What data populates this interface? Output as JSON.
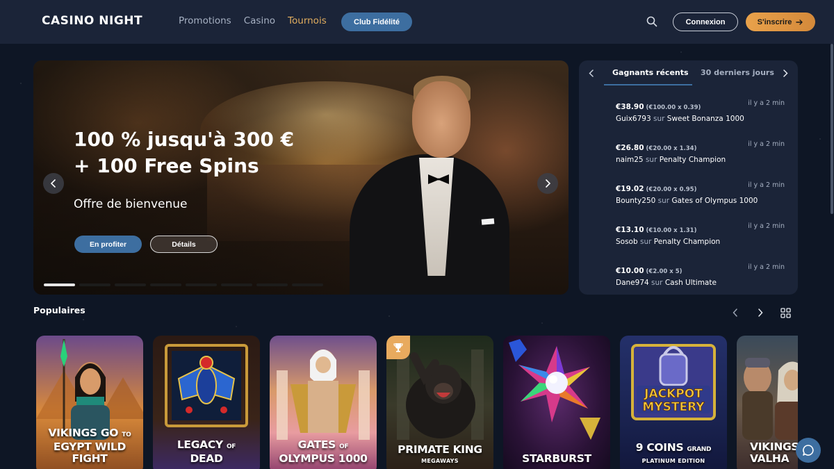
{
  "header": {
    "logo": "CASINO NIGHT",
    "nav": [
      {
        "label": "Promotions",
        "active": false
      },
      {
        "label": "Casino",
        "active": false
      },
      {
        "label": "Tournois",
        "active": true
      }
    ],
    "club_label": "Club Fidélité",
    "login_label": "Connexion",
    "signup_label": "S'inscrire",
    "accent": "#e0ac5e",
    "primary": "#3d6ea0"
  },
  "hero": {
    "title": "100 % jusqu'à 300 € + 100 Free Spins",
    "subtitle": "Offre de bienvenue",
    "cta_label": "En profiter",
    "details_label": "Détails",
    "slide_count": 8,
    "active_slide": 1
  },
  "winners": {
    "tabs": [
      "Gagnants récents",
      "30 derniers jours"
    ],
    "active_tab": 0,
    "items": [
      {
        "amount": "€38.90",
        "calc": "(€100.00 x 0.39)",
        "time": "il y a 2 min",
        "user": "Guix6793",
        "sur": "sur",
        "game": "Sweet Bonanza 1000"
      },
      {
        "amount": "€26.80",
        "calc": "(€20.00 x 1.34)",
        "time": "il y a 2 min",
        "user": "naim25",
        "sur": "sur",
        "game": "Penalty Champion"
      },
      {
        "amount": "€19.02",
        "calc": "(€20.00 x 0.95)",
        "time": "il y a 2 min",
        "user": "Bounty250",
        "sur": "sur",
        "game": "Gates of Olympus 1000"
      },
      {
        "amount": "€13.10",
        "calc": "(€10.00 x 1.31)",
        "time": "il y a 2 min",
        "user": "Sosob",
        "sur": "sur",
        "game": "Penalty Champion"
      },
      {
        "amount": "€10.00",
        "calc": "(€2.00 x 5)",
        "time": "il y a 2 min",
        "user": "Dane974",
        "sur": "sur",
        "game": "Cash Ultimate"
      }
    ]
  },
  "popular": {
    "title": "Populaires",
    "games": [
      {
        "line1": "VIKINGS GO",
        "small1": "TO",
        "line2": "EGYPT WILD",
        "line3": "FIGHT",
        "sub": "",
        "icon": "pharaoh-warrior"
      },
      {
        "line1": "LEGACY",
        "small1": "OF",
        "line2": "DEAD",
        "line3": "",
        "sub": "",
        "icon": "scarab"
      },
      {
        "line1": "GATES",
        "small1": "OF",
        "line2": "OLYMPUS 1000",
        "line3": "",
        "sub": "",
        "icon": "zeus"
      },
      {
        "line1": "PRIMATE KING",
        "small1": "",
        "line2": "",
        "line3": "",
        "sub": "MEGAWAYS",
        "icon": "gorilla",
        "badge": "trophy-icon"
      },
      {
        "line1": "STARBURST",
        "small1": "",
        "line2": "",
        "line3": "",
        "sub": "",
        "icon": "star-gem"
      },
      {
        "line1": "9 COINS",
        "small1": "GRAND",
        "line2": "",
        "line3": "",
        "sub": "PLATINUM EDITION",
        "icon": "jackpot-mystery",
        "art_text1": "JACKPOT",
        "art_text2": "MYSTERY"
      },
      {
        "line1": "VIKINGS",
        "small1": "",
        "line2": "VALHA",
        "line3": "",
        "sub": "",
        "icon": "vikings"
      }
    ]
  }
}
